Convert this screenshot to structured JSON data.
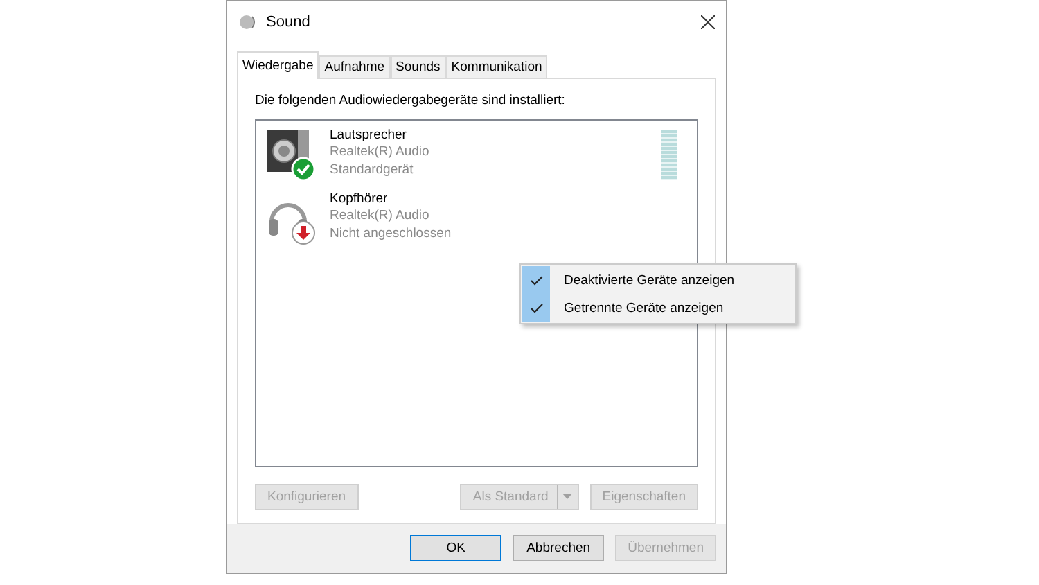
{
  "window": {
    "title": "Sound"
  },
  "tabs": [
    {
      "label": "Wiedergabe",
      "selected": true
    },
    {
      "label": "Aufnahme",
      "selected": false
    },
    {
      "label": "Sounds",
      "selected": false
    },
    {
      "label": "Kommunikation",
      "selected": false
    }
  ],
  "instruction": "Die folgenden Audiowiedergabegeräte sind installiert:",
  "devices": [
    {
      "kind": "speaker",
      "name": "Lautsprecher",
      "driver": "Realtek(R) Audio",
      "status_text": "Standardgerät",
      "default": true,
      "connected": true
    },
    {
      "kind": "headphones",
      "name": "Kopfhörer",
      "driver": "Realtek(R) Audio",
      "status_text": "Nicht angeschlossen",
      "default": false,
      "connected": false
    }
  ],
  "context_menu": [
    {
      "label": "Deaktivierte Geräte anzeigen",
      "checked": true
    },
    {
      "label": "Getrennte Geräte anzeigen",
      "checked": true
    }
  ],
  "panel_buttons": [
    {
      "label": "Konfigurieren",
      "disabled": true,
      "kind": "plain"
    },
    {
      "label": "Als Standard",
      "disabled": true,
      "kind": "split"
    },
    {
      "label": "Eigenschaften",
      "disabled": true,
      "kind": "plain"
    }
  ],
  "dialog_buttons": [
    {
      "label": "OK",
      "disabled": false,
      "default": true
    },
    {
      "label": "Abbrechen",
      "disabled": false,
      "default": false
    },
    {
      "label": "Übernehmen",
      "disabled": true,
      "default": false
    }
  ]
}
